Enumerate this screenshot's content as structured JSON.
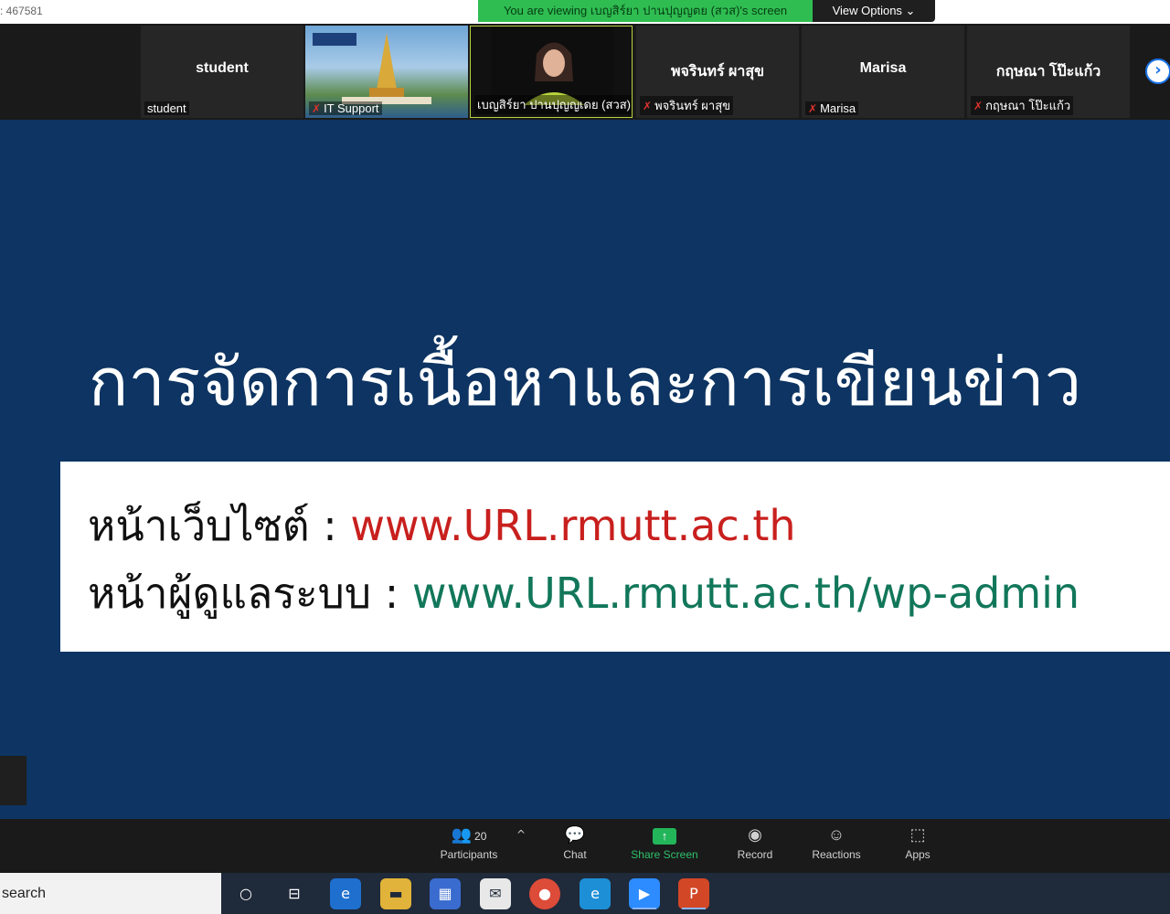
{
  "topbar": {
    "meeting_id": ": 467581",
    "viewing_banner": "You are viewing เบญสิร์ยา ปานปุญญตย (สวส)'s screen",
    "view_options": "View Options ⌄"
  },
  "participants": [
    {
      "big_name": "student",
      "label": "student",
      "muted": false
    },
    {
      "big_name": "",
      "label": "IT Support",
      "muted": true
    },
    {
      "big_name": "",
      "label": "เบญสิร์ยา ปานปุญญเดย (สวส)",
      "muted": false
    },
    {
      "big_name": "พจรินทร์ ผาสุข",
      "label": "พจรินทร์ ผาสุข",
      "muted": true
    },
    {
      "big_name": "Marisa",
      "label": "Marisa",
      "muted": true
    },
    {
      "big_name": "กฤษณา โป๊ะแก้ว",
      "label": "กฤษณา โป๊ะแก้ว",
      "muted": true
    }
  ],
  "slide": {
    "title": "การจัดการเนื้อหาและการเขียนข่าว",
    "row1_label": "หน้าเว็บไซต์  : ",
    "row1_url": "www.URL.rmutt.ac.th",
    "row2_label": "หน้าผู้ดูแลระบบ : ",
    "row2_url": "www.URL.rmutt.ac.th/wp-admin"
  },
  "toolbar": {
    "participants_label": "Participants",
    "participants_count": "20",
    "chat_label": "Chat",
    "share_label": "Share Screen",
    "record_label": "Record",
    "reactions_label": "Reactions",
    "apps_label": "Apps"
  },
  "taskbar": {
    "search_text": "search"
  },
  "colors": {
    "slide_bg": "#0d3462",
    "banner_green": "#2fbd52",
    "url_red": "#c8201e",
    "url_green": "#12775a"
  }
}
